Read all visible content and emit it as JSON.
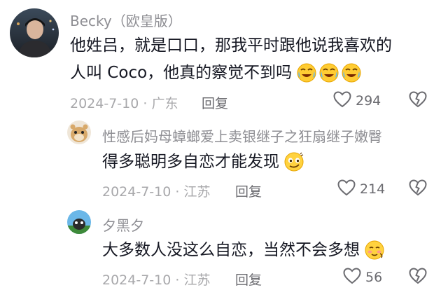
{
  "comments": [
    {
      "username": "Becky（欧皇版）",
      "text_line1": "他姓吕，就是口口，那我平时跟他说我喜欢的",
      "text_line2": "人叫 Coco，他真的察觉不到吗",
      "emojis": [
        "crying-laughing-emoji",
        "crying-laughing-emoji",
        "crying-laughing-emoji"
      ],
      "date_location": "2024-7-10 · 广东",
      "reply_label": "回复",
      "like_count": "294"
    },
    {
      "username": "性感后妈母蟑螂爱上卖银继子之狂扇继子嫩臀",
      "text": "得多聪明多自恋才能发现",
      "emojis": [
        "smirk-emoji"
      ],
      "date_location": "2024-7-10 · 江苏",
      "reply_label": "回复",
      "like_count": "214"
    },
    {
      "username": "夕黑夕",
      "text": "大多数人没这么自恋，当然不会多想",
      "emojis": [
        "blushing-emoji"
      ],
      "date_location": "2024-7-10 · 江苏",
      "reply_label": "回复",
      "like_count": "56"
    }
  ]
}
